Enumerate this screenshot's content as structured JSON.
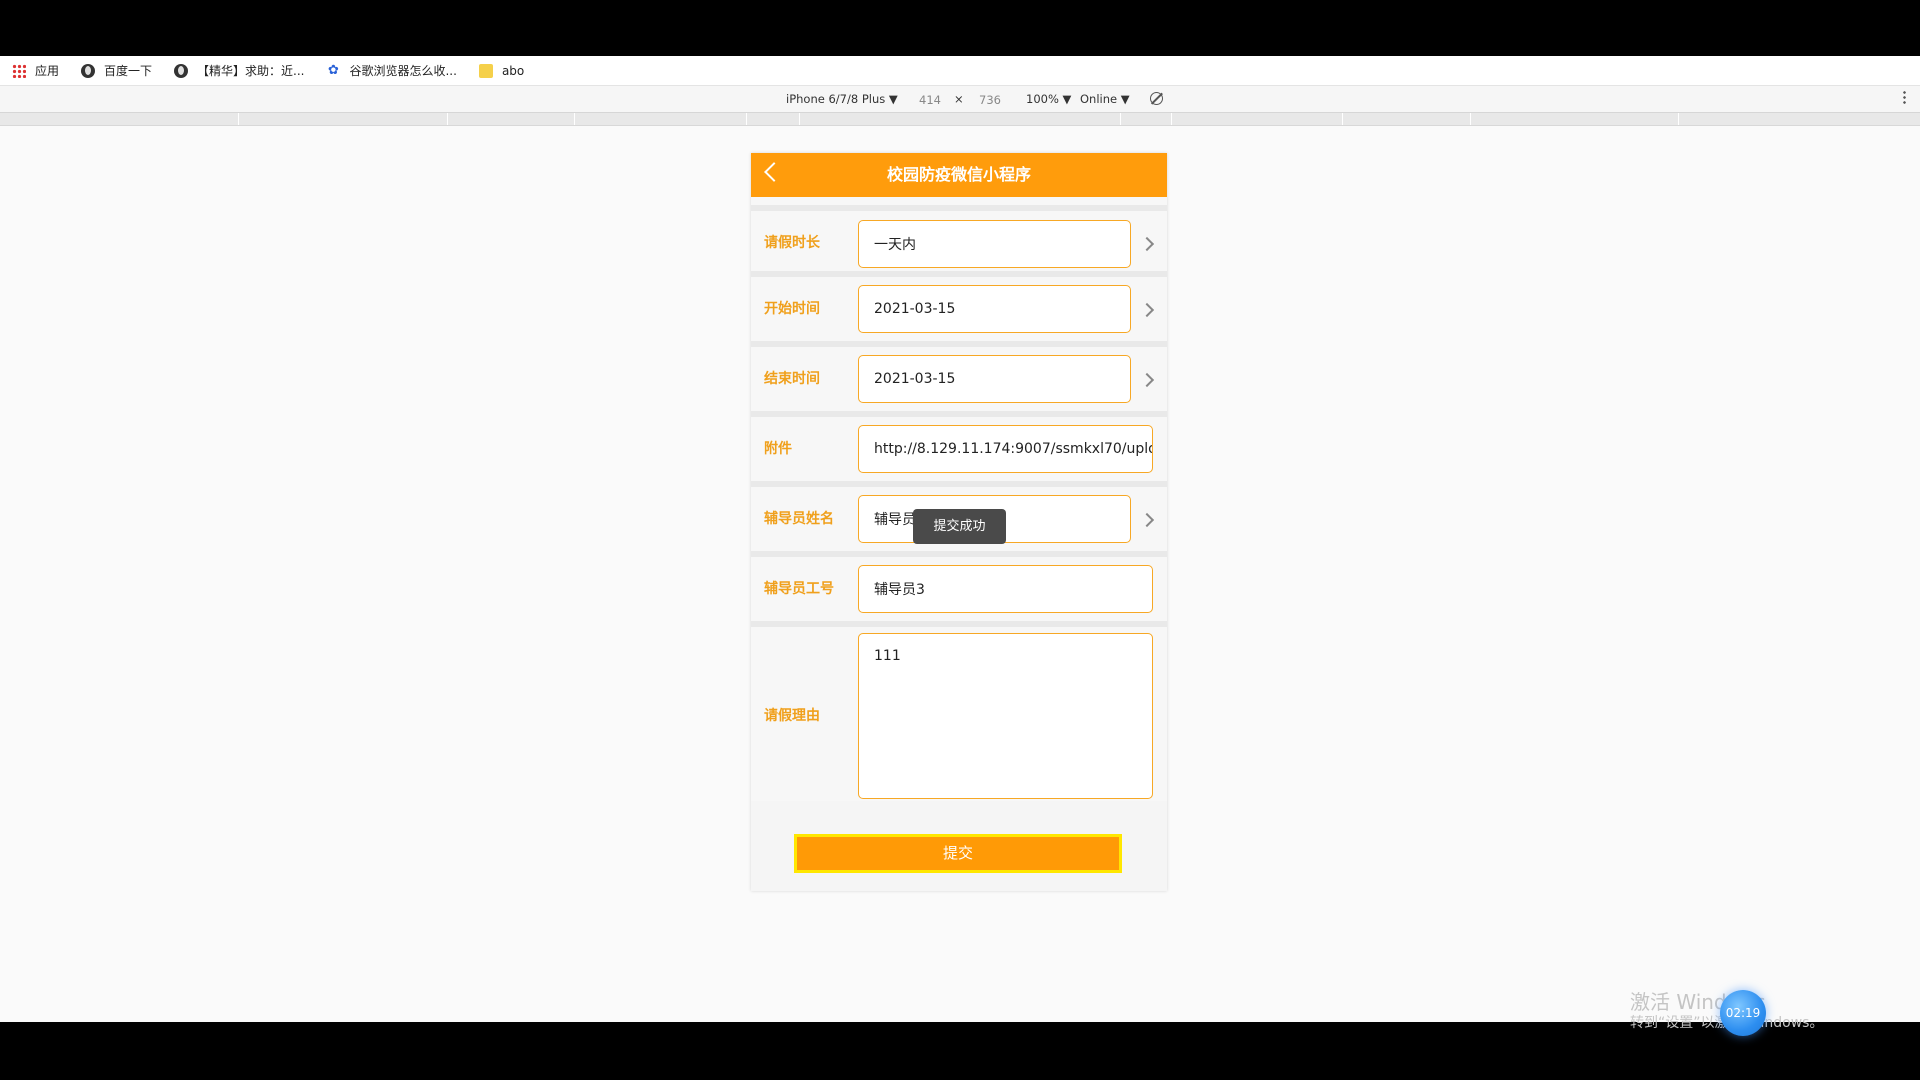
{
  "bookmarks": [
    {
      "label": "应用",
      "icon": "apps-grid-icon"
    },
    {
      "label": "百度一下",
      "icon": "globe-icon"
    },
    {
      "label": "【精华】求助：近...",
      "icon": "globe-icon"
    },
    {
      "label": "谷歌浏览器怎么收...",
      "icon": "paw-icon"
    },
    {
      "label": "abo",
      "icon": "folder-icon"
    }
  ],
  "devtools": {
    "device": "iPhone 6/7/8 Plus ▼",
    "width": "414",
    "times": "×",
    "height": "736",
    "zoom": "100% ▼",
    "network": "Online ▼"
  },
  "app": {
    "title": "校园防疫微信小程序",
    "fields": [
      {
        "label": "请假时长",
        "value": "一天内",
        "chevron": true
      },
      {
        "label": "开始时间",
        "value": "2021-03-15",
        "chevron": true
      },
      {
        "label": "结束时间",
        "value": "2021-03-15",
        "chevron": true
      },
      {
        "label": "附件",
        "value": "http://8.129.11.174:9007/ssmkxl70/uplo",
        "chevron": false
      },
      {
        "label": "辅导员姓名",
        "value": "辅导员姓名3",
        "chevron": true
      },
      {
        "label": "辅导员工号",
        "value": "辅导员3",
        "chevron": false
      },
      {
        "label": "请假理由",
        "value": "111",
        "chevron": false
      }
    ],
    "toast": "提交成功",
    "submit_label": "提交"
  },
  "watermark": {
    "line1": "激活 Windows",
    "line2": "转到“设置”以激活 Windows。",
    "clock": "02:19"
  }
}
